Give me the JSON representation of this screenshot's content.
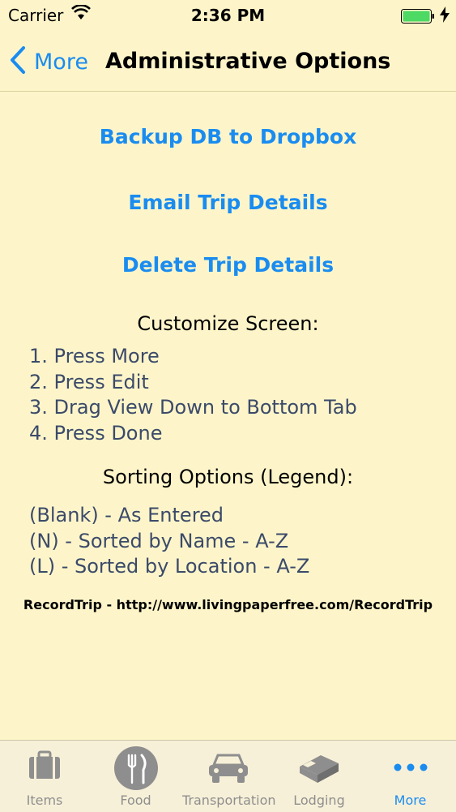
{
  "status_bar": {
    "carrier": "Carrier",
    "time": "2:36 PM",
    "colors": {
      "battery": "#4cd964"
    }
  },
  "nav": {
    "back_label": "More",
    "title": "Administrative Options"
  },
  "actions": {
    "backup": "Backup DB to Dropbox",
    "email": "Email Trip Details",
    "delete": "Delete Trip Details"
  },
  "customize": {
    "heading": "Customize Screen:",
    "steps": [
      "1. Press More",
      "2. Press Edit",
      "3. Drag View Down to Bottom Tab",
      "4. Press Done"
    ]
  },
  "sorting": {
    "heading": "Sorting Options (Legend):",
    "items": [
      "(Blank) - As Entered",
      "(N) - Sorted by Name - A-Z",
      "(L) - Sorted by Location - A-Z"
    ]
  },
  "footer": {
    "link": "RecordTrip - http://www.livingpaperfree.com/RecordTrip"
  },
  "tabs": [
    {
      "label": "Items",
      "icon": "briefcase-icon"
    },
    {
      "label": "Food",
      "icon": "fork-knife-icon"
    },
    {
      "label": "Transportation",
      "icon": "car-icon"
    },
    {
      "label": "Lodging",
      "icon": "bed-icon"
    },
    {
      "label": "More",
      "icon": "more-dots-icon",
      "active": true
    }
  ],
  "colors": {
    "accent": "#1a8cf0",
    "background": "#fdf5c9",
    "list_text": "#3c4a6a"
  }
}
